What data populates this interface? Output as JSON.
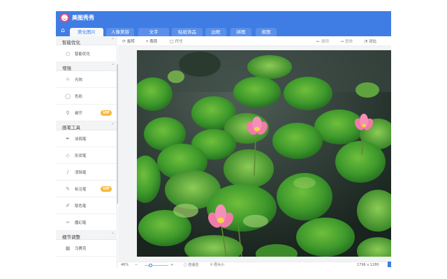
{
  "app": {
    "title": "美图秀秀"
  },
  "tabs": [
    {
      "label": "美化图片",
      "active": true
    },
    {
      "label": "人像美容",
      "active": false
    },
    {
      "label": "文字",
      "active": false
    },
    {
      "label": "贴纸饰品",
      "active": false
    },
    {
      "label": "边框",
      "active": false
    },
    {
      "label": "拼图",
      "active": false
    },
    {
      "label": "抠图",
      "active": false
    }
  ],
  "sidebar": {
    "sections": [
      {
        "title": "智能优化",
        "items": [
          {
            "label": "智能优化",
            "icon": "bulb-icon",
            "vip": false
          }
        ]
      },
      {
        "title": "增强",
        "items": [
          {
            "label": "光效",
            "icon": "sun-icon",
            "vip": false
          },
          {
            "label": "色彩",
            "icon": "palette-icon",
            "vip": false
          },
          {
            "label": "细节",
            "icon": "magnifier-icon",
            "vip": true
          }
        ]
      },
      {
        "title": "画笔工具",
        "items": [
          {
            "label": "涂鸦笔",
            "icon": "brush-icon",
            "vip": false
          },
          {
            "label": "形状笔",
            "icon": "shape-pen-icon",
            "vip": false
          },
          {
            "label": "消除笔",
            "icon": "eraser-icon",
            "vip": false
          },
          {
            "label": "标注笔",
            "icon": "marker-icon",
            "vip": true
          },
          {
            "label": "取色笔",
            "icon": "eyedropper-icon",
            "vip": false
          },
          {
            "label": "魔幻笔",
            "icon": "magic-pen-icon",
            "vip": false
          }
        ]
      },
      {
        "title": "细节调整",
        "items": [
          {
            "label": "马赛克",
            "icon": "mosaic-icon",
            "vip": false
          }
        ]
      }
    ],
    "vip_label": "VIP"
  },
  "toolbar": {
    "rotate": "旋转",
    "crop": "裁剪",
    "size": "尺寸",
    "undo": "撤销",
    "redo": "重做",
    "compare": "对比"
  },
  "status": {
    "zoom": "46%",
    "fit": "自适应",
    "original": "原大小",
    "dimensions": "1796 x 1280"
  },
  "colors": {
    "accent": "#3f7ce4",
    "vip": "#f6b93b",
    "brand": "#e94e74"
  }
}
